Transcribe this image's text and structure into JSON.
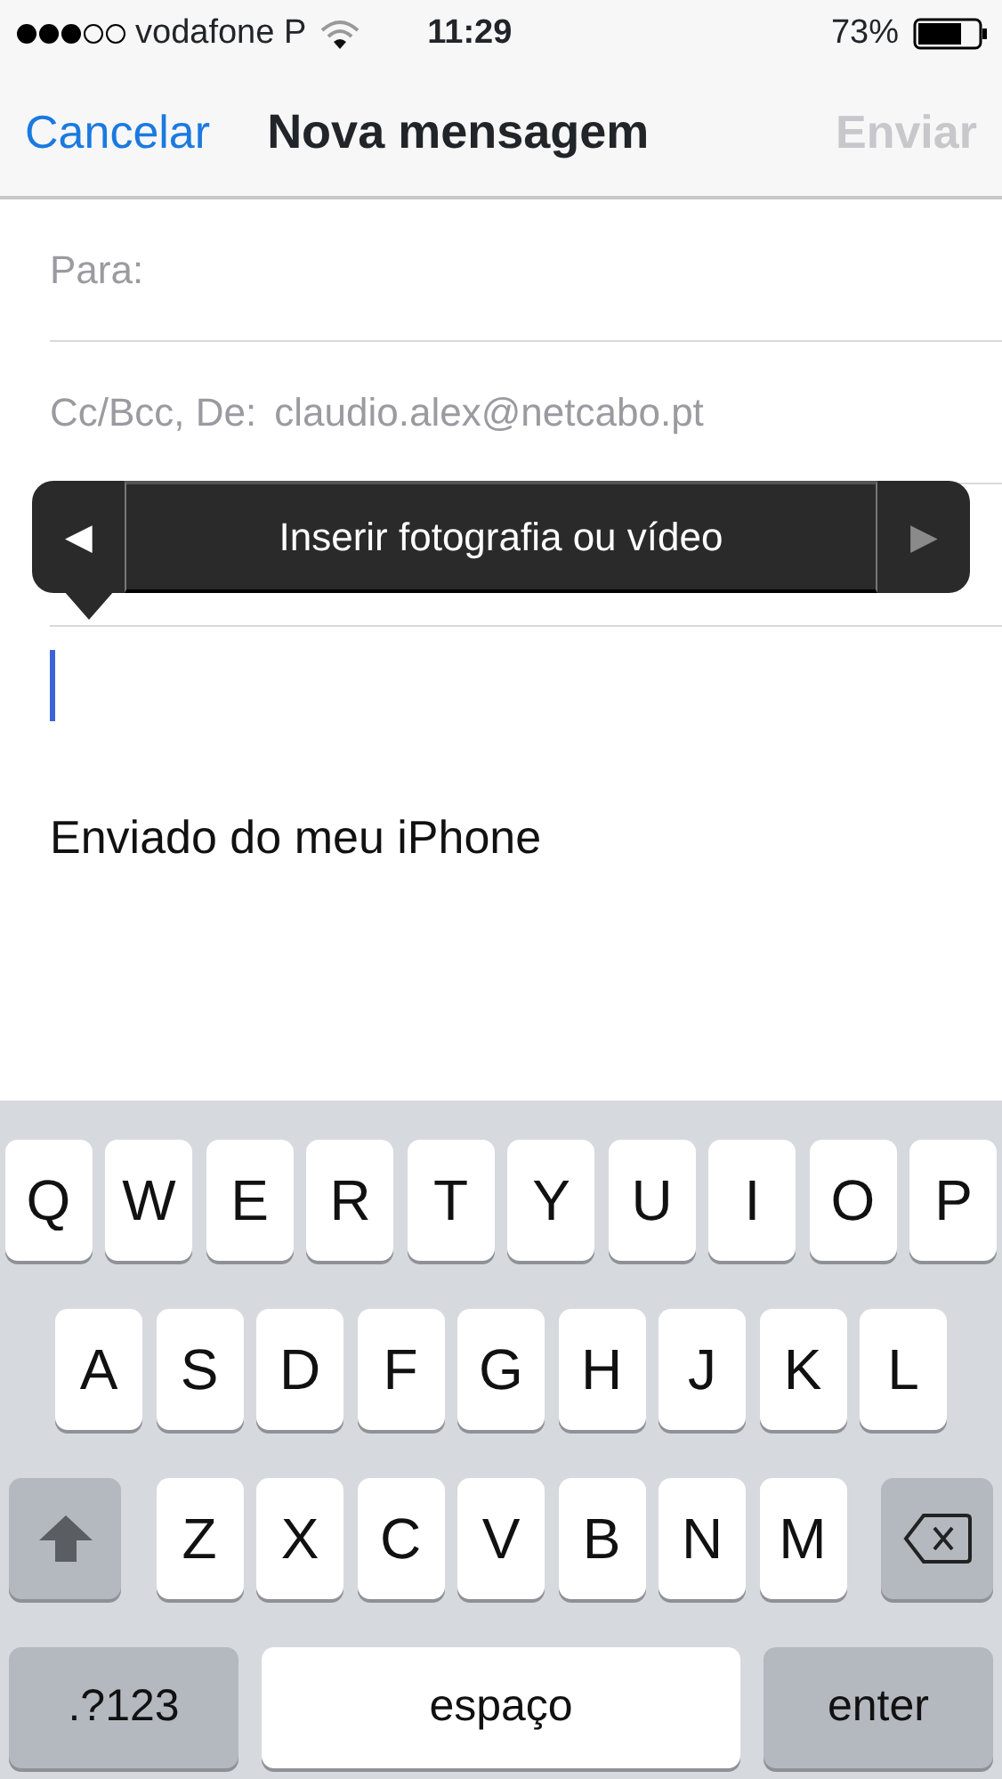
{
  "status_bar": {
    "carrier": "vodafone P",
    "time": "11:29",
    "battery": "73%"
  },
  "nav": {
    "cancel": "Cancelar",
    "title": "Nova mensagem",
    "send": {
      "label": "Enviar",
      "disabled": true
    }
  },
  "fields": [
    {
      "label": "Para:"
    },
    {
      "label": "Cc/Bcc, De:",
      "value": "claudio.alex@netcabo.pt"
    }
  ],
  "popover": {
    "prev": {
      "label": "◀",
      "disabled": false
    },
    "text": "Inserir fotografia ou vídeo",
    "next": {
      "label": "▶",
      "disabled": true
    }
  },
  "body": {
    "signature": "Enviado do meu iPhone"
  },
  "keyboard": {
    "letter_rows": [
      {
        "kind": "plain",
        "keys": [
          "Q",
          "W",
          "E",
          "R",
          "T",
          "Y",
          "U",
          "I",
          "O",
          "P"
        ]
      },
      {
        "kind": "plain",
        "keys": [
          "A",
          "S",
          "D",
          "F",
          "G",
          "H",
          "J",
          "K",
          "L"
        ]
      },
      {
        "kind": "shift_delete",
        "keys": [
          "Z",
          "X",
          "C",
          "V",
          "B",
          "N",
          "M"
        ]
      }
    ],
    "bottom": {
      "mode": ".?123",
      "space": "espaço",
      "enter": "enter"
    }
  }
}
